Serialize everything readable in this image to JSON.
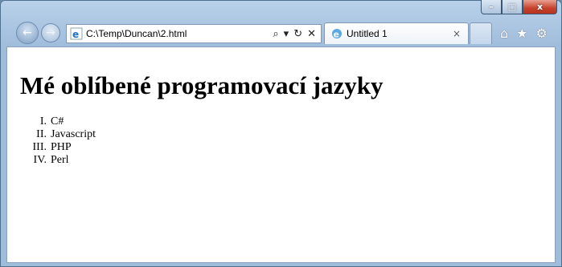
{
  "window": {
    "caption_buttons": {
      "minimize": "–",
      "maximize": "□",
      "close": "x"
    }
  },
  "nav": {
    "back_icon": "back-arrow-icon",
    "forward_icon": "forward-arrow-icon"
  },
  "address_bar": {
    "url": "C:\\Temp\\Duncan\\2.html",
    "search_glyph": "⌕",
    "dropdown_glyph": "▾",
    "refresh_glyph": "↻",
    "stop_glyph": "✕"
  },
  "tab": {
    "title": "Untitled 1",
    "close_glyph": "×"
  },
  "toolbar_icons": {
    "home": "⌂",
    "favorites": "★",
    "tools": "⚙"
  },
  "page": {
    "heading": "Mé oblíbené programovací jazyky",
    "list": [
      {
        "num": "I.",
        "text": "C#"
      },
      {
        "num": "II.",
        "text": "Javascript"
      },
      {
        "num": "III.",
        "text": "PHP"
      },
      {
        "num": "IV.",
        "text": "Perl"
      }
    ]
  },
  "colors": {
    "frame": "#a8c3e0",
    "close_button": "#c7422c",
    "content_bg": "#ffffff"
  }
}
